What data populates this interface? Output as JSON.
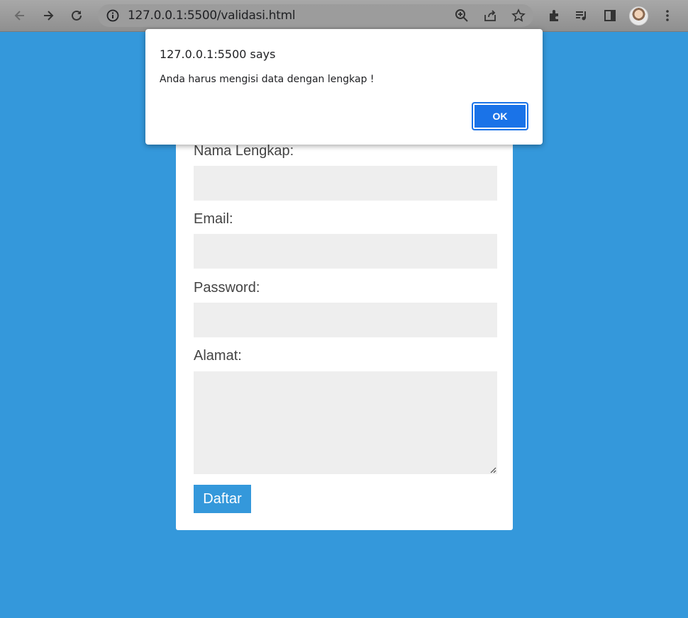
{
  "browser": {
    "url": "127.0.0.1:5500/validasi.html",
    "icons": [
      "back-icon",
      "forward-icon",
      "reload-icon",
      "info-icon",
      "zoom-icon",
      "share-icon",
      "bookmark-star-icon",
      "extensions-icon",
      "media-icon",
      "side-panel-icon",
      "profile-avatar",
      "menu-icon"
    ]
  },
  "form": {
    "labels": {
      "name": "Nama Lengkap:",
      "email": "Email:",
      "password": "Password:",
      "address": "Alamat:"
    },
    "values": {
      "name": "",
      "email": "",
      "password": "",
      "address": ""
    },
    "submit_label": "Daftar"
  },
  "dialog": {
    "title": "127.0.0.1:5500 says",
    "message": "Anda harus mengisi data dengan lengkap !",
    "ok_label": "OK"
  },
  "colors": {
    "page_background": "#3498db",
    "accent": "#3498db",
    "dialog_button": "#1a73e8",
    "field_background": "#eeeeee"
  }
}
